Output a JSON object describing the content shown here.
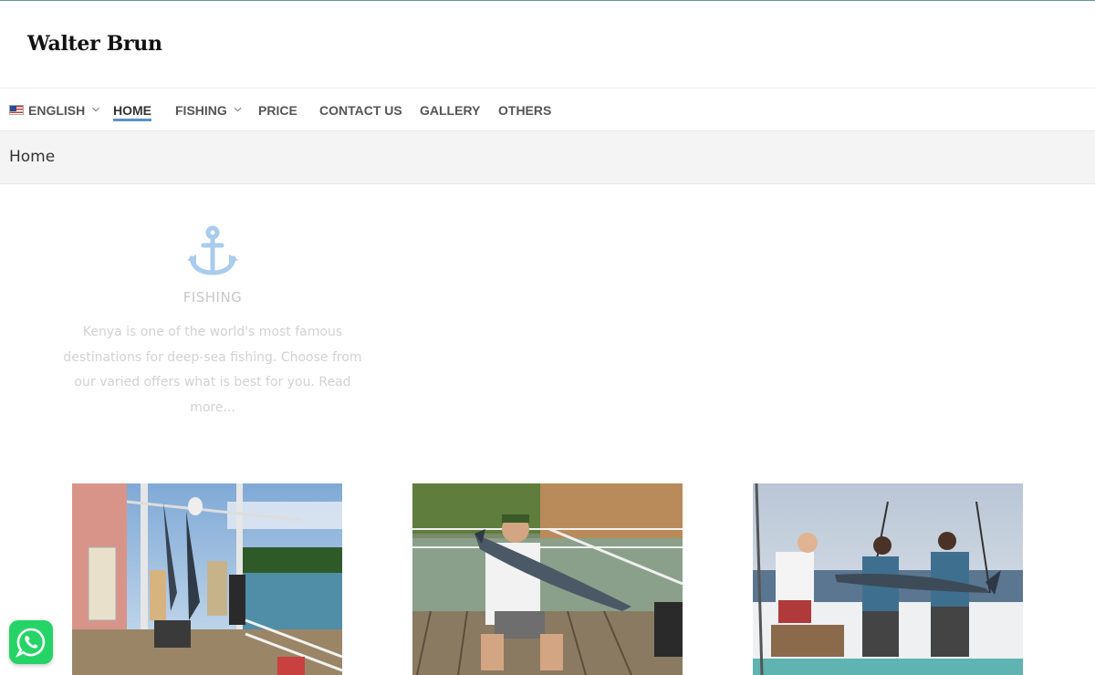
{
  "site": {
    "title": "Walter Brun"
  },
  "nav": {
    "language": {
      "label": "ENGLISH",
      "icon": "us-flag-icon"
    },
    "items": [
      {
        "label": "HOME",
        "active": true
      },
      {
        "label": "FISHING",
        "has_submenu": true
      },
      {
        "label": "PRICE"
      },
      {
        "label": "CONTACT US"
      },
      {
        "label": "GALLERY"
      },
      {
        "label": "OTHERS"
      }
    ],
    "accent_color": "#5a90c8"
  },
  "page": {
    "heading": "Home"
  },
  "feature": {
    "icon": "anchor-icon",
    "icon_color": "#a9cbec",
    "title": "FISHING",
    "text": "Kenya is one of the world's most famous destinations for deep-sea fishing. Choose from our varied offers what is best for you. Read more..."
  },
  "gallery": {
    "photos": [
      {
        "subject": "fishing-dock-catch-photo"
      },
      {
        "subject": "angler-with-wahoo-photo"
      },
      {
        "subject": "boat-crew-with-marlin-photo"
      }
    ]
  },
  "widgets": {
    "whatsapp": {
      "icon": "whatsapp-icon",
      "color": "#25d366"
    }
  }
}
